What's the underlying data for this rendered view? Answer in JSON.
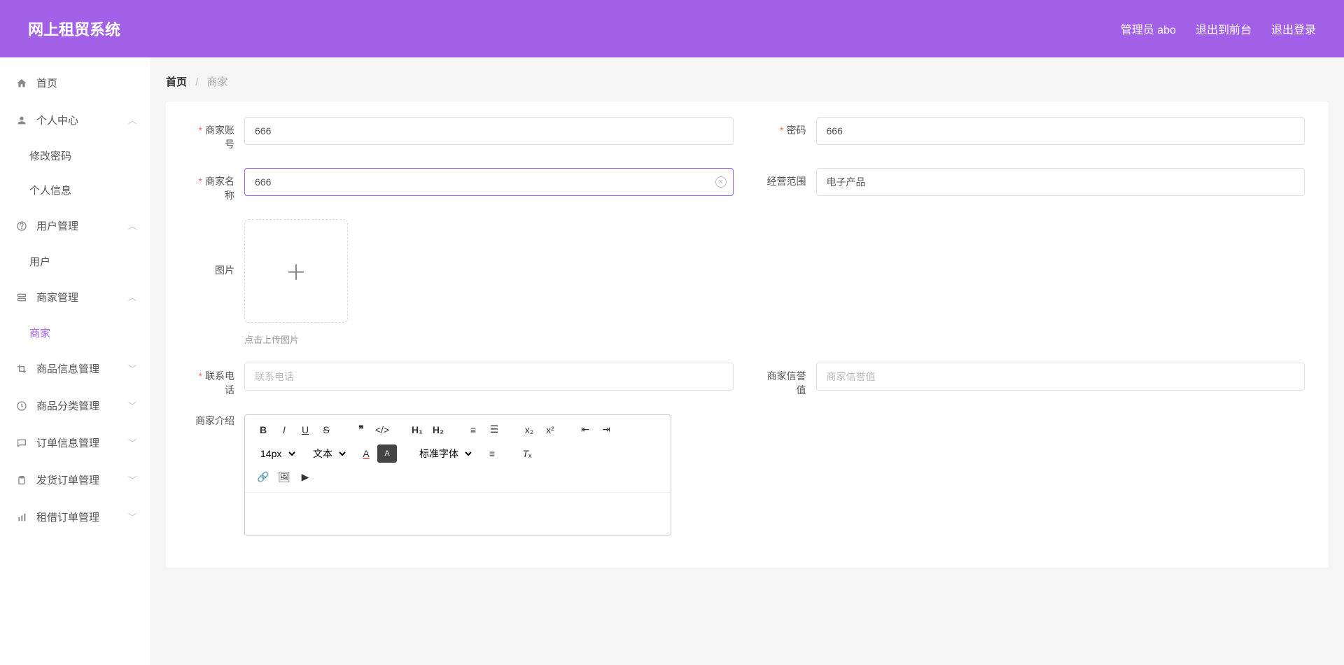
{
  "header": {
    "title": "网上租贸系统",
    "admin": "管理员 abo",
    "back_to_front": "退出到前台",
    "logout": "退出登录"
  },
  "sidebar": {
    "home": "首页",
    "personal": {
      "label": "个人中心",
      "modify_pwd": "修改密码",
      "info": "个人信息"
    },
    "user_mgmt": {
      "label": "用户管理",
      "users": "用户"
    },
    "merchant_mgmt": {
      "label": "商家管理",
      "merchant": "商家"
    },
    "product_info": "商品信息管理",
    "product_cat": "商品分类管理",
    "order_info": "订单信息管理",
    "ship_order": "发货订单管理",
    "lease_order": "租借订单管理"
  },
  "breadcrumb": {
    "home": "首页",
    "current": "商家"
  },
  "form": {
    "account": {
      "label": "商家账号",
      "value": "666"
    },
    "password": {
      "label": "密码",
      "value": "666"
    },
    "name": {
      "label": "商家名称",
      "value": "666"
    },
    "scope": {
      "label": "经营范围",
      "value": "电子产品"
    },
    "image": {
      "label": "图片",
      "hint": "点击上传图片"
    },
    "phone": {
      "label": "联系电话",
      "placeholder": "联系电话"
    },
    "reputation": {
      "label": "商家信誉值",
      "placeholder": "商家信誉值"
    },
    "intro": {
      "label": "商家介绍"
    }
  },
  "editor": {
    "font_size": "14px",
    "block_type": "文本",
    "font_family": "标准字体"
  }
}
